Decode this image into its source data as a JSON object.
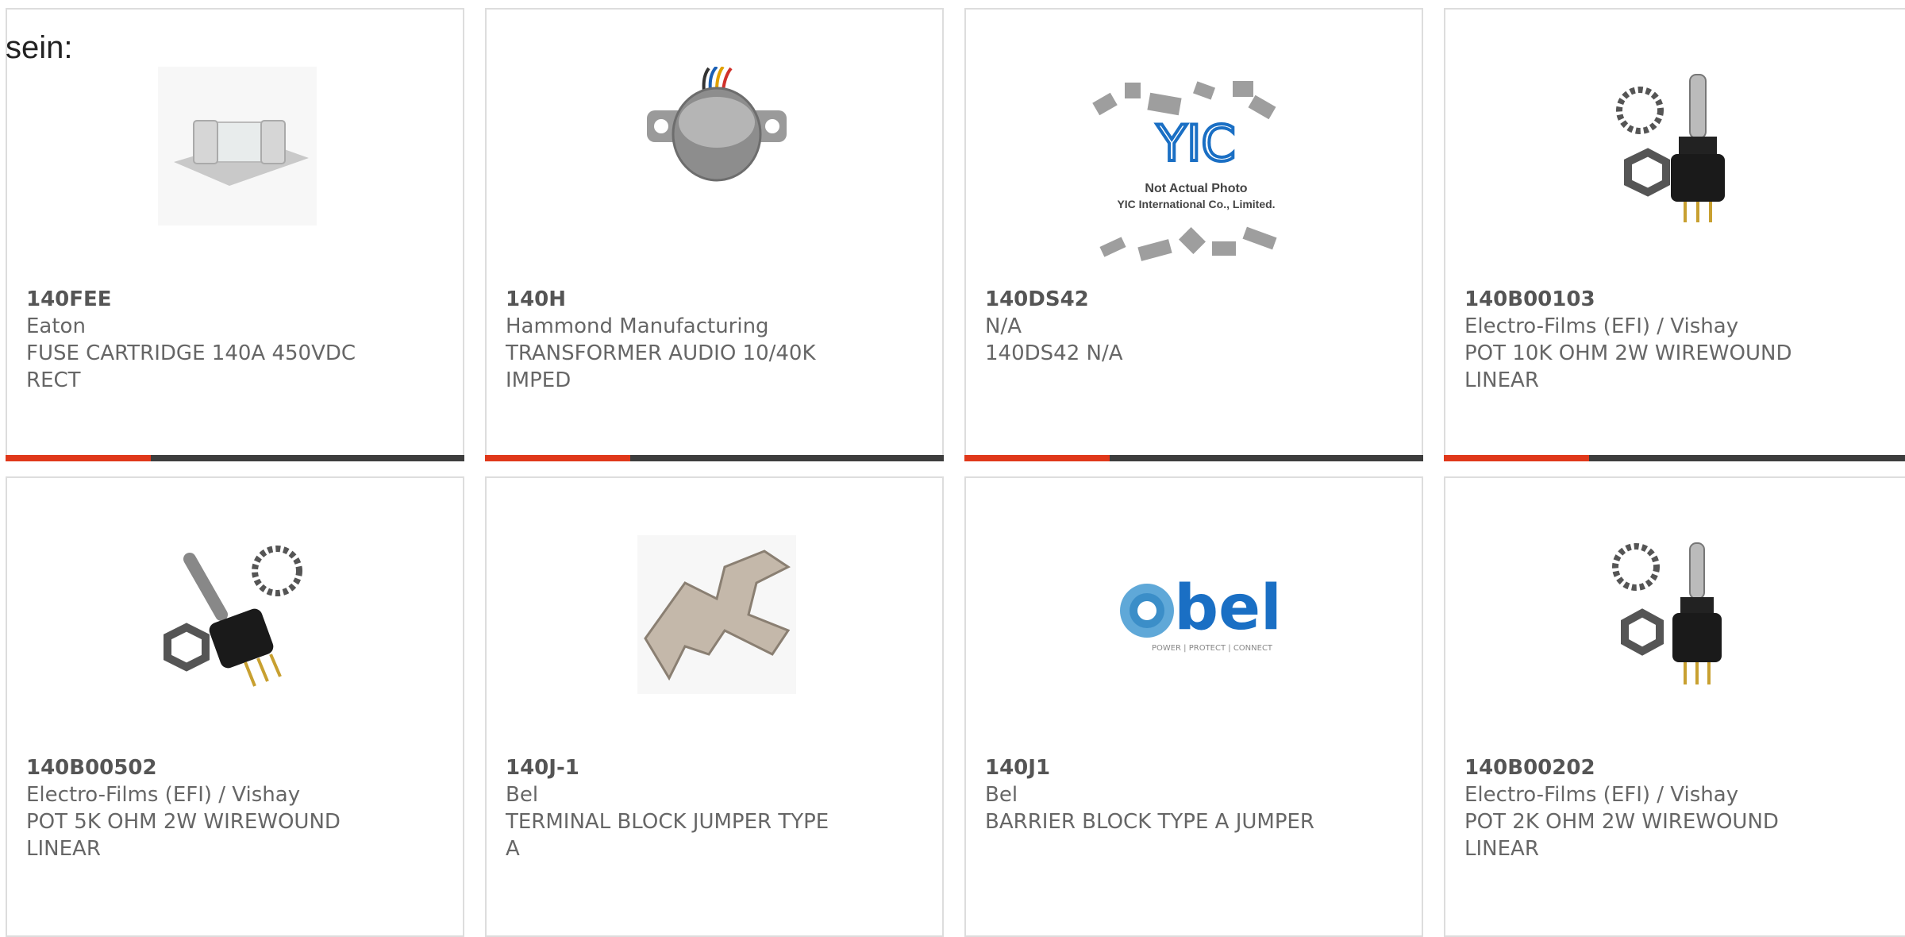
{
  "heading": "sein:",
  "colors": {
    "accent": "#e0381a",
    "bar_dark": "#3d3d3d",
    "border": "#dddddd"
  },
  "products": [
    {
      "part": "140FEE",
      "mfr": "Eaton",
      "desc": [
        "FUSE CARTRIDGE 140A 450VDC",
        "RECT"
      ],
      "image": "fuse-cartridge-image"
    },
    {
      "part": "140H",
      "mfr": "Hammond Manufacturing",
      "desc": [
        "TRANSFORMER AUDIO 10/40K",
        "IMPED"
      ],
      "image": "audio-transformer-image"
    },
    {
      "part": "140DS42",
      "mfr": "N/A",
      "desc": [
        "140DS42 N/A",
        ""
      ],
      "image": "not-actual-photo-placeholder",
      "placeholder_text": [
        "Not Actual Photo",
        "YIC International Co., Limited."
      ],
      "placeholder_logo": "YIC"
    },
    {
      "part": "140B00103",
      "mfr": "Electro-Films (EFI) / Vishay",
      "desc": [
        "POT 10K OHM 2W WIREWOUND",
        "LINEAR"
      ],
      "image": "potentiometer-image"
    },
    {
      "part": "140B00502",
      "mfr": "Electro-Films (EFI) / Vishay",
      "desc": [
        "POT 5K OHM 2W WIREWOUND",
        "LINEAR"
      ],
      "image": "potentiometer-image"
    },
    {
      "part": "140J-1",
      "mfr": "Bel",
      "desc": [
        "TERMINAL BLOCK JUMPER TYPE",
        "A"
      ],
      "image": "jumper-bracket-image"
    },
    {
      "part": "140J1",
      "mfr": "Bel",
      "desc": [
        "BARRIER BLOCK TYPE A JUMPER",
        ""
      ],
      "image": "bel-logo",
      "logo_text": "bel",
      "logo_tagline": "POWER | PROTECT | CONNECT"
    },
    {
      "part": "140B00202",
      "mfr": "Electro-Films (EFI) / Vishay",
      "desc": [
        "POT 2K OHM 2W WIREWOUND",
        "LINEAR"
      ],
      "image": "potentiometer-image"
    }
  ]
}
